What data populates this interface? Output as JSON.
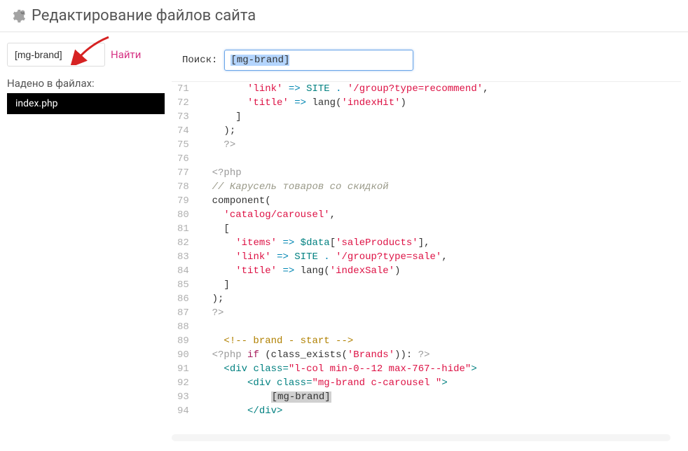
{
  "header": {
    "title": "Редактирование файлов сайта"
  },
  "sidebar": {
    "search_value": "[mg-brand]",
    "find_label": "Найти",
    "found_label": "Надено в файлах:",
    "files": [
      "index.php"
    ]
  },
  "editor": {
    "search_label": "Поиск:",
    "search_value": "[mg-brand]",
    "first_line": 71,
    "lines": [
      {
        "indent": 4,
        "tokens": [
          [
            "str",
            "'link'"
          ],
          [
            "fn",
            " "
          ],
          [
            "kw",
            "=>"
          ],
          [
            "fn",
            " "
          ],
          [
            "var",
            "SITE"
          ],
          [
            "fn",
            " "
          ],
          [
            "kw",
            "."
          ],
          [
            "fn",
            " "
          ],
          [
            "str",
            "'/group?type=recommend'"
          ],
          [
            "fn",
            ","
          ]
        ]
      },
      {
        "indent": 4,
        "tokens": [
          [
            "str",
            "'title'"
          ],
          [
            "fn",
            " "
          ],
          [
            "kw",
            "=>"
          ],
          [
            "fn",
            " lang"
          ],
          [
            "fn",
            "("
          ],
          [
            "str",
            "'indexHit'"
          ],
          [
            "fn",
            ")"
          ]
        ]
      },
      {
        "indent": 3,
        "tokens": [
          [
            "fn",
            "]"
          ]
        ]
      },
      {
        "indent": 2,
        "tokens": [
          [
            "fn",
            ");"
          ]
        ]
      },
      {
        "indent": 2,
        "tokens": [
          [
            "php",
            "?>"
          ]
        ]
      },
      {
        "indent": 0,
        "tokens": []
      },
      {
        "indent": 1,
        "tokens": [
          [
            "php",
            "<?php"
          ]
        ]
      },
      {
        "indent": 1,
        "tokens": [
          [
            "comment",
            "// Карусель товаров со скидкой"
          ]
        ]
      },
      {
        "indent": 1,
        "tokens": [
          [
            "fn",
            "component("
          ]
        ]
      },
      {
        "indent": 2,
        "tokens": [
          [
            "str",
            "'catalog/carousel'"
          ],
          [
            "fn",
            ","
          ]
        ]
      },
      {
        "indent": 2,
        "tokens": [
          [
            "fn",
            "["
          ]
        ]
      },
      {
        "indent": 3,
        "tokens": [
          [
            "str",
            "'items'"
          ],
          [
            "fn",
            " "
          ],
          [
            "kw",
            "=>"
          ],
          [
            "fn",
            " "
          ],
          [
            "var",
            "$data"
          ],
          [
            "fn",
            "["
          ],
          [
            "str",
            "'saleProducts'"
          ],
          [
            "fn",
            "],"
          ]
        ]
      },
      {
        "indent": 3,
        "tokens": [
          [
            "str",
            "'link'"
          ],
          [
            "fn",
            " "
          ],
          [
            "kw",
            "=>"
          ],
          [
            "fn",
            " "
          ],
          [
            "var",
            "SITE"
          ],
          [
            "fn",
            " "
          ],
          [
            "kw",
            "."
          ],
          [
            "fn",
            " "
          ],
          [
            "str",
            "'/group?type=sale'"
          ],
          [
            "fn",
            ","
          ]
        ]
      },
      {
        "indent": 3,
        "tokens": [
          [
            "str",
            "'title'"
          ],
          [
            "fn",
            " "
          ],
          [
            "kw",
            "=>"
          ],
          [
            "fn",
            " lang"
          ],
          [
            "fn",
            "("
          ],
          [
            "str",
            "'indexSale'"
          ],
          [
            "fn",
            ")"
          ]
        ]
      },
      {
        "indent": 2,
        "tokens": [
          [
            "fn",
            "]"
          ]
        ]
      },
      {
        "indent": 1,
        "tokens": [
          [
            "fn",
            ");"
          ]
        ]
      },
      {
        "indent": 1,
        "tokens": [
          [
            "php",
            "?>"
          ]
        ]
      },
      {
        "indent": 0,
        "tokens": []
      },
      {
        "indent": 2,
        "tokens": [
          [
            "htmlcomment",
            "<!-- brand - start -->"
          ]
        ]
      },
      {
        "indent": 1,
        "tokens": [
          [
            "php",
            "<?php"
          ],
          [
            "fn",
            " "
          ],
          [
            "op",
            "if"
          ],
          [
            "fn",
            " (class_exists("
          ],
          [
            "str",
            "'Brands'"
          ],
          [
            "fn",
            ")): "
          ],
          [
            "php",
            "?>"
          ]
        ]
      },
      {
        "indent": 2,
        "tokens": [
          [
            "tag",
            "<div "
          ],
          [
            "attr",
            "class"
          ],
          [
            "tag",
            "="
          ],
          [
            "class",
            "\"l-col min-0--12 max-767--hide\""
          ],
          [
            "tag",
            ">"
          ]
        ]
      },
      {
        "indent": 4,
        "tokens": [
          [
            "tag",
            "<div "
          ],
          [
            "attr",
            "class"
          ],
          [
            "tag",
            "="
          ],
          [
            "class",
            "\"mg-brand c-carousel \""
          ],
          [
            "tag",
            ">"
          ]
        ]
      },
      {
        "indent": 6,
        "tokens": [
          [
            "hl",
            "[mg-brand]"
          ]
        ]
      },
      {
        "indent": 4,
        "tokens": [
          [
            "tag",
            "</div>"
          ]
        ]
      }
    ]
  }
}
